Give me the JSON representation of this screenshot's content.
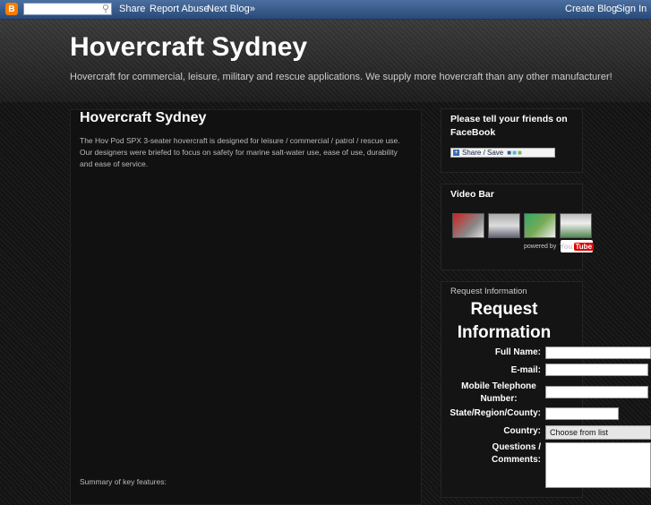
{
  "navbar": {
    "logo": "B",
    "search_placeholder": "",
    "share": "Share",
    "report_abuse": "Report Abuse",
    "next_blog": "Next Blog»",
    "create_blog": "Create Blog",
    "sign_in": "Sign In"
  },
  "header": {
    "title": "Hovercraft Sydney",
    "description": "Hovercraft for commercial, leisure, military and rescue applications. We supply more hovercraft than any other manufacturer!"
  },
  "post": {
    "title": "Hovercraft Sydney",
    "body": "The Hov Pod SPX 3-seater hovercraft is designed for leisure / commercial / patrol / rescue use. Our designers were briefed to focus on safety for marine salt-water use, ease of use, durability and ease of service.",
    "summary": "Summary of key features:"
  },
  "sidebar": {
    "facebook_widget": {
      "title": "Please tell your friends on FaceBook",
      "share_label": "Share / Save"
    },
    "video_bar": {
      "title": "Video Bar",
      "powered_by": "powered by",
      "you": "You",
      "tube": "Tube"
    },
    "request_info": {
      "title": "Request Information",
      "heading": "Request Information",
      "full_name": "Full Name:",
      "email": "E-mail:",
      "mobile": "Mobile Telephone Number:",
      "state": "State/Region/County:",
      "country": "Country:",
      "country_value": "Choose from list",
      "questions": "Questions / Comments:"
    }
  }
}
